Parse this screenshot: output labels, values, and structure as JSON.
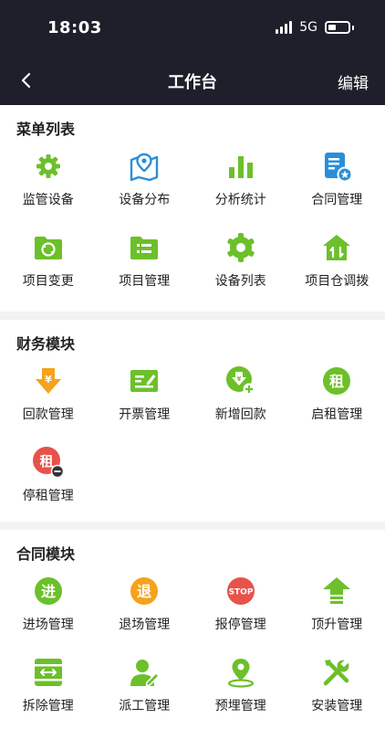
{
  "status_bar": {
    "time": "18:03",
    "network": "5G"
  },
  "nav": {
    "title": "工作台",
    "edit_label": "编辑"
  },
  "sections": [
    {
      "title": "菜单列表",
      "items": [
        {
          "label": "监管设备",
          "icon": "gear-icon"
        },
        {
          "label": "设备分布",
          "icon": "map-pin-icon"
        },
        {
          "label": "分析统计",
          "icon": "bar-chart-icon"
        },
        {
          "label": "合同管理",
          "icon": "contract-doc-icon"
        },
        {
          "label": "项目变更",
          "icon": "folder-sync-icon"
        },
        {
          "label": "项目管理",
          "icon": "folder-list-icon"
        },
        {
          "label": "设备列表",
          "icon": "cog-icon"
        },
        {
          "label": "项目仓调拨",
          "icon": "warehouse-transfer-icon"
        }
      ]
    },
    {
      "title": "财务模块",
      "items": [
        {
          "label": "回款管理",
          "icon": "yuan-down-arrow-icon"
        },
        {
          "label": "开票管理",
          "icon": "invoice-icon"
        },
        {
          "label": "新增回款",
          "icon": "add-payment-icon",
          "glyph": "¥"
        },
        {
          "label": "启租管理",
          "icon": "start-rent-icon",
          "glyph": "租"
        },
        {
          "label": "停租管理",
          "icon": "stop-rent-icon",
          "glyph": "租"
        }
      ]
    },
    {
      "title": "合同模块",
      "items": [
        {
          "label": "进场管理",
          "icon": "enter-site-icon",
          "glyph": "进"
        },
        {
          "label": "退场管理",
          "icon": "exit-site-icon",
          "glyph": "退"
        },
        {
          "label": "报停管理",
          "icon": "stop-sign-icon",
          "glyph": "STOP"
        },
        {
          "label": "顶升管理",
          "icon": "lift-up-icon"
        },
        {
          "label": "拆除管理",
          "icon": "dismantle-icon"
        },
        {
          "label": "派工管理",
          "icon": "dispatch-worker-icon"
        },
        {
          "label": "预埋管理",
          "icon": "embed-location-icon"
        },
        {
          "label": "安装管理",
          "icon": "install-tools-icon"
        }
      ]
    }
  ],
  "colors": {
    "green": "#6cc02a",
    "blue": "#2a8fd8",
    "orange": "#f5a21c",
    "red": "#e8524a",
    "dark": "#1e1f2b"
  }
}
